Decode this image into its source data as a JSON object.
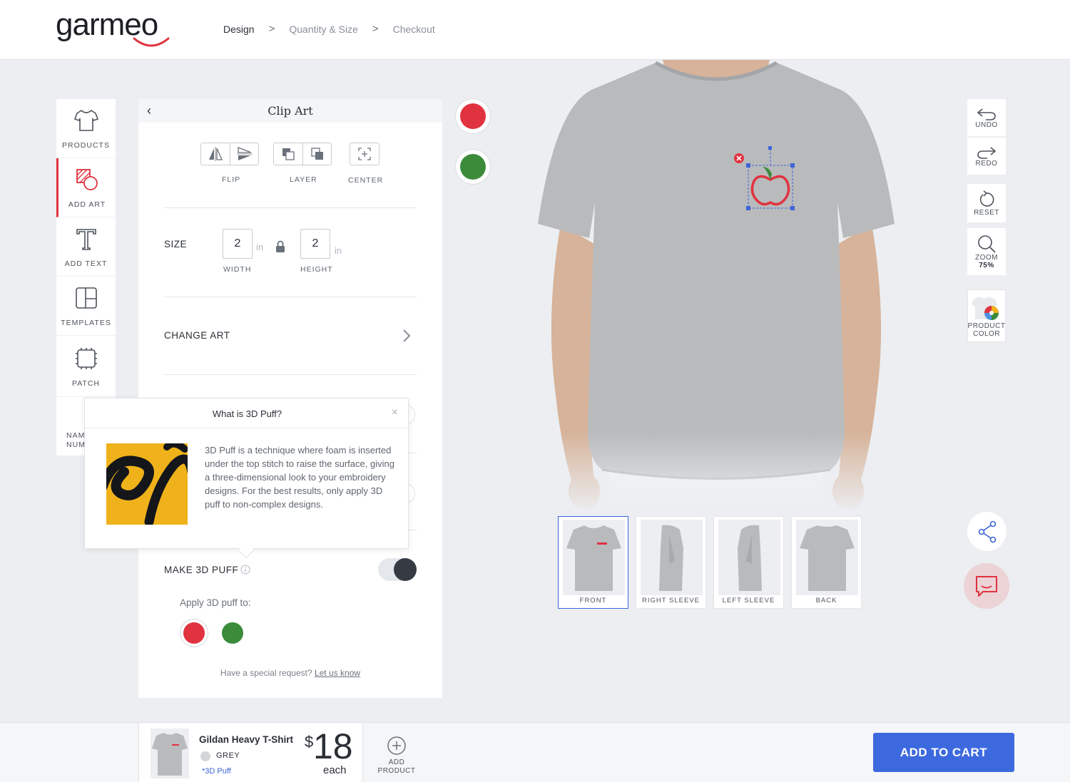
{
  "brand": {
    "name": "garmeo",
    "accent": "#e0333f"
  },
  "breadcrumb": [
    {
      "label": "Design",
      "active": true
    },
    {
      "label": "Quantity & Size",
      "active": false
    },
    {
      "label": "Checkout",
      "active": false
    }
  ],
  "toolbar": {
    "products": "PRODUCTS",
    "add_art": "ADD ART",
    "add_text": "ADD TEXT",
    "templates": "TEMPLATES",
    "patch": "PATCH",
    "name_num_1": "NAM",
    "name_num_2": "NUM"
  },
  "panel": {
    "title": "Clip Art",
    "flip": "FLIP",
    "layer": "LAYER",
    "center": "CENTER",
    "size_label": "SIZE",
    "width_value": "2",
    "height_value": "2",
    "unit": "in",
    "width_label": "WIDTH",
    "height_label": "HEIGHT",
    "change_art": "CHANGE ART",
    "make_puff": "MAKE 3D PUFF",
    "puff_enabled": true,
    "apply_to": "Apply 3D puff to:",
    "special_text": "Have a special request?",
    "special_link": "Let us know"
  },
  "popup": {
    "title": "What is 3D Puff?",
    "body": "3D Puff is a technique where foam is inserted under the top stitch to raise the surface, giving a three-dimensional look to your embroidery designs. For the best results, only apply 3D puff to non-complex designs."
  },
  "art_colors": [
    "#e0333f",
    "#3b8b3b"
  ],
  "views": [
    {
      "label": "FRONT",
      "active": true
    },
    {
      "label": "RIGHT SLEEVE",
      "active": false
    },
    {
      "label": "LEFT SLEEVE",
      "active": false
    },
    {
      "label": "BACK",
      "active": false
    }
  ],
  "right_tools": {
    "undo": "UNDO",
    "redo": "REDO",
    "reset": "RESET",
    "zoom": "ZOOM",
    "zoom_value": "75%",
    "product": "PRODUCT",
    "color": "COLOR"
  },
  "footer": {
    "product_name": "Gildan Heavy T-Shirt",
    "color_name": "GREY",
    "note": "*3D Puff",
    "price_currency": "$",
    "price_value": "18",
    "price_unit": "each",
    "add_product_1": "ADD",
    "add_product_2": "PRODUCT",
    "cart": "ADD TO CART"
  }
}
